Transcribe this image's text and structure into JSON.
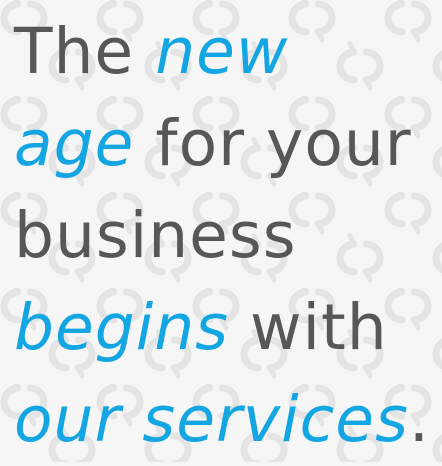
{
  "headline": {
    "line1": {
      "plain": "The ",
      "accent": "new"
    },
    "line2": {
      "accent": "age",
      "plain": " for your"
    },
    "line3": {
      "plain": "business"
    },
    "line4": {
      "accent": "begins",
      "plain": " with"
    },
    "line5": {
      "accent": "our services",
      "period": "."
    }
  },
  "colors": {
    "text": "#575757",
    "accent": "#14a6e2",
    "background": "#f6f6f6",
    "pattern": "#e6e6e6"
  },
  "background_pattern_icon": "circular-arrows-icon"
}
